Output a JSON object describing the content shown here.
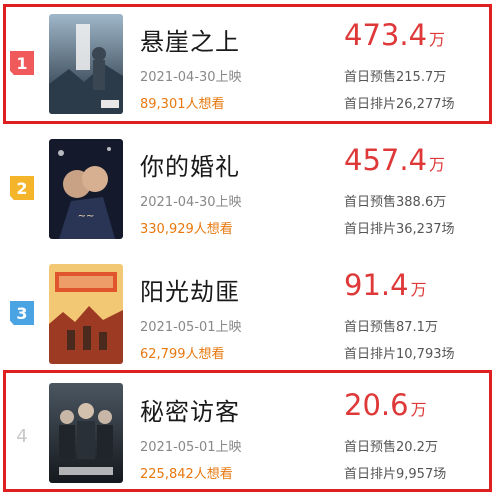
{
  "movies": [
    {
      "rank": "1",
      "title": "悬崖之上",
      "date": "2021-04-30上映",
      "want": "89,301人想看",
      "gross_value": "473.4",
      "gross_unit": "万",
      "presale": "首日预售215.7万",
      "shows": "首日排片26,277场",
      "highlighted": true,
      "rank_color": "#f05a5a",
      "poster_colors": [
        "#6f8aa1",
        "#1d2a38"
      ]
    },
    {
      "rank": "2",
      "title": "你的婚礼",
      "date": "2021-04-30上映",
      "want": "330,929人想看",
      "gross_value": "457.4",
      "gross_unit": "万",
      "presale": "首日预售388.6万",
      "shows": "首日排片36,237场",
      "highlighted": false,
      "rank_color": "#f5b52a",
      "poster_colors": [
        "#1e2a44",
        "#0b0f1c"
      ]
    },
    {
      "rank": "3",
      "title": "阳光劫匪",
      "date": "2021-05-01上映",
      "want": "62,799人想看",
      "gross_value": "91.4",
      "gross_unit": "万",
      "presale": "首日预售87.1万",
      "shows": "首日排片10,793场",
      "highlighted": false,
      "rank_color": "#4aa3e3",
      "poster_colors": [
        "#f2c26b",
        "#b8482a"
      ]
    },
    {
      "rank": "4",
      "title": "秘密访客",
      "date": "2021-05-01上映",
      "want": "225,842人想看",
      "gross_value": "20.6",
      "gross_unit": "万",
      "presale": "首日预售20.2万",
      "shows": "首日排片9,957场",
      "highlighted": true,
      "rank_color": "",
      "poster_colors": [
        "#3c4650",
        "#15191e"
      ]
    }
  ]
}
